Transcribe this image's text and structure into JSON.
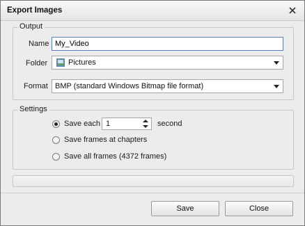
{
  "window": {
    "title": "Export Images"
  },
  "output": {
    "group_label": "Output",
    "name_label": "Name",
    "name_value": "My_Video",
    "folder_label": "Folder",
    "folder_value": "Pictures",
    "format_label": "Format",
    "format_value": "BMP (standard Windows Bitmap file format)"
  },
  "settings": {
    "group_label": "Settings",
    "options": [
      {
        "label": "Save each",
        "checked": true
      },
      {
        "label": "Save frames at chapters",
        "checked": false
      },
      {
        "label": "Save all frames (4372 frames)",
        "checked": false
      }
    ],
    "interval_value": "1",
    "interval_unit": "second"
  },
  "buttons": {
    "save": "Save",
    "close": "Close"
  },
  "icons": {
    "close": "close-icon",
    "folder": "folder-icon",
    "dropdown": "chevron-down-icon",
    "spin_up": "spin-up-icon",
    "spin_down": "spin-down-icon"
  }
}
